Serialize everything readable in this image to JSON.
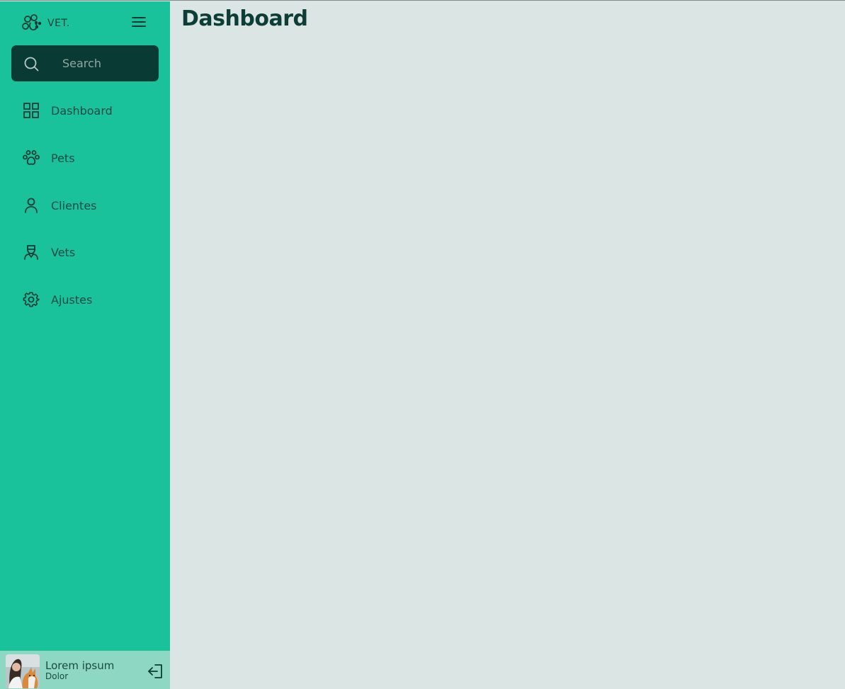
{
  "brand": {
    "name": "VET.",
    "icon": "paw-logo-icon"
  },
  "search": {
    "placeholder": "Search",
    "value": ""
  },
  "nav": {
    "items": [
      {
        "label": "Dashboard",
        "icon": "grid-icon"
      },
      {
        "label": "Pets",
        "icon": "paw-icon"
      },
      {
        "label": "Clientes",
        "icon": "user-icon"
      },
      {
        "label": "Vets",
        "icon": "vet-icon"
      },
      {
        "label": "Ajustes",
        "icon": "gear-icon"
      }
    ]
  },
  "user": {
    "name": "Lorem ipsum",
    "role": "Dolor"
  },
  "main": {
    "title": "Dashboard"
  },
  "colors": {
    "sidebar": "#1ac29c",
    "search_bg": "#093b34",
    "content_bg": "#dbe5e3",
    "user_bar": "#8ed8c3",
    "text_dark": "#0c3d36"
  }
}
